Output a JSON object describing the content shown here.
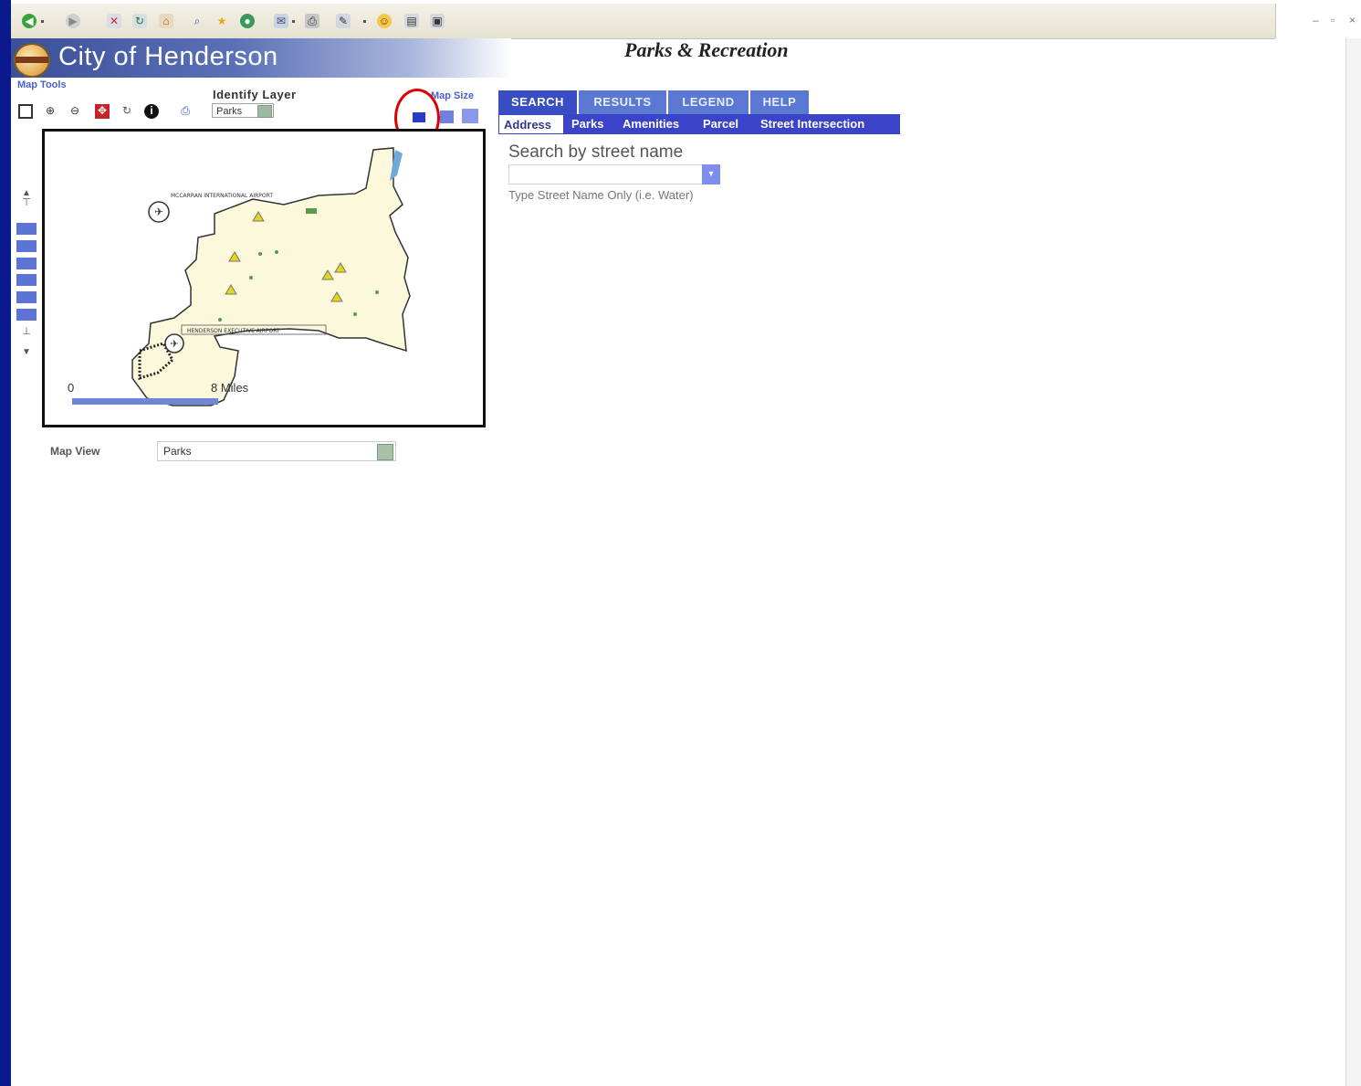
{
  "app": {
    "city_name": "City of Henderson",
    "section_title": "Parks & Recreation"
  },
  "toolbar_icons": [
    "back-icon",
    "forward-icon",
    "stop-icon",
    "refresh-icon",
    "home-icon",
    "search-icon",
    "favorites-icon",
    "history-icon",
    "mail-icon",
    "print-icon",
    "edit-icon",
    "messenger-icon",
    "research-icon",
    "bookmark-icon"
  ],
  "map_tools": {
    "label": "Map Tools",
    "tools": [
      "full-extent-icon",
      "zoom-in-icon",
      "zoom-out-icon",
      "pan-icon",
      "refresh-map-icon",
      "identify-icon",
      "print-map-icon"
    ]
  },
  "identify": {
    "label": "Identify Layer",
    "value": "Parks"
  },
  "map_size": {
    "label": "Map Size"
  },
  "tabs": [
    {
      "label": "SEARCH",
      "active": true
    },
    {
      "label": "RESULTS",
      "active": false
    },
    {
      "label": "LEGEND",
      "active": false
    },
    {
      "label": "HELP",
      "active": false
    }
  ],
  "subtabs": [
    {
      "label": "Address",
      "active": true
    },
    {
      "label": "Parks",
      "active": false
    },
    {
      "label": "Amenities",
      "active": false
    },
    {
      "label": "Parcel",
      "active": false
    },
    {
      "label": "Street Intersection",
      "active": false
    }
  ],
  "search": {
    "heading": "Search by street name",
    "input_value": "",
    "hint": "Type Street Name Only (i.e. Water)"
  },
  "map": {
    "scale_start": "0",
    "scale_end": "8 Miles",
    "airport_label": "MCCARRAN INTERNATIONAL AIRPORT",
    "road_label": "HENDERSON EXECUTIVE AIRPORT"
  },
  "map_view": {
    "label": "Map View",
    "value": "Parks"
  },
  "colors": {
    "tab_blue": "#5b79d3",
    "subtab_blue": "#3b44c9",
    "highlight_red": "#e00000",
    "map_land": "#fbf8dc"
  }
}
